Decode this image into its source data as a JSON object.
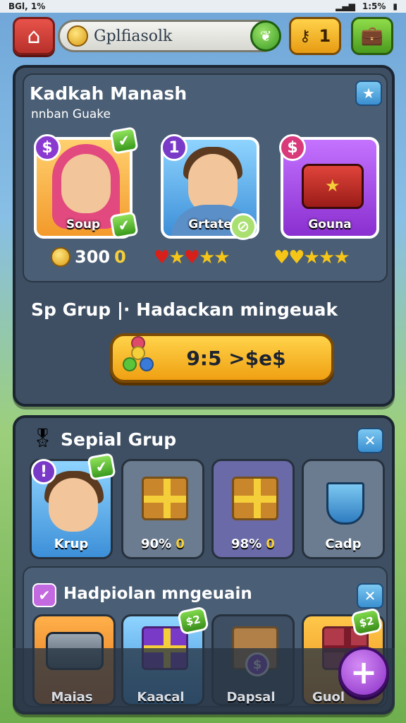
{
  "status": {
    "left": "BGl, 1%",
    "right": "1:5%"
  },
  "topbar": {
    "search_text": "Gplfiasolk",
    "keys_count": "1"
  },
  "panel1": {
    "title": "Kadkah Manash",
    "subtitle": "nnban Guake",
    "cards": [
      {
        "label": "Soup",
        "badge": "$"
      },
      {
        "label": "Grtate",
        "badge": "1"
      },
      {
        "label": "Gouna",
        "badge": "$"
      }
    ],
    "stats": {
      "coins": "300",
      "coin_suffix": "0"
    },
    "heading": "Sp Grup  |·  Hadackan mingeuak",
    "play_label": "9:5 >$e$"
  },
  "panel2": {
    "title": "Sepial Grup",
    "tiles": [
      {
        "label": "Krup",
        "badge": "!"
      },
      {
        "label": "90%",
        "suffix": "0"
      },
      {
        "label": "98%",
        "suffix": "0"
      },
      {
        "label": "Cadp"
      }
    ],
    "section_title": "Hadpiolan mngeuain",
    "tags": [
      "$2",
      "$2"
    ],
    "item_tag": "$"
  },
  "nav": {
    "items": [
      "Maias",
      "Kaacal",
      "Dapsal",
      "Guol"
    ],
    "plus": "+"
  },
  "colors": {
    "accent_yellow": "#f0a012",
    "panel": "#3e4f63",
    "green": "#3a9a22",
    "purple": "#8a2fc8"
  }
}
